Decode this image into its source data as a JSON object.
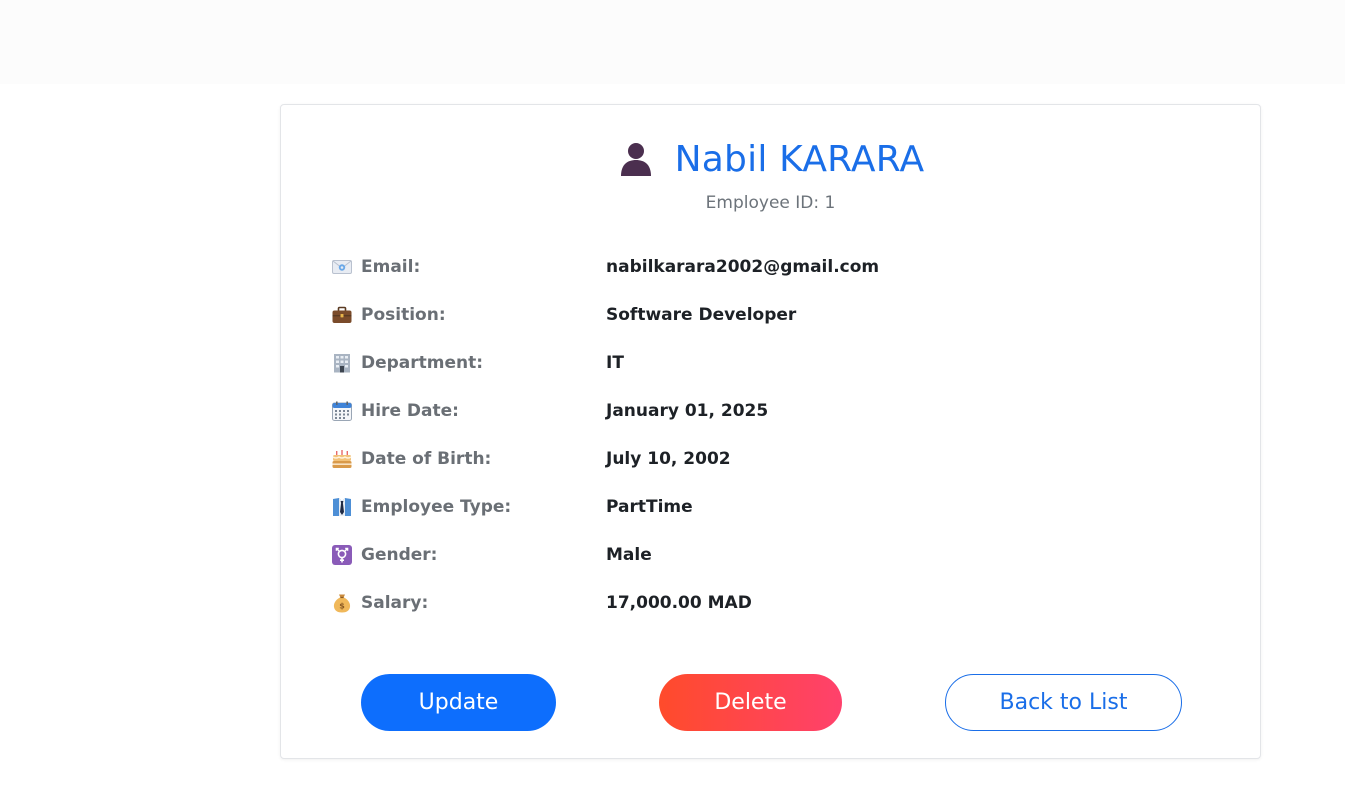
{
  "profile": {
    "name": "Nabil KARARA",
    "employee_id_label": "Employee ID: 1"
  },
  "details": [
    {
      "icon": "envelope-icon",
      "label": "Email:",
      "value": "nabilkarara2002@gmail.com"
    },
    {
      "icon": "briefcase-icon",
      "label": "Position:",
      "value": "Software Developer"
    },
    {
      "icon": "office-building-icon",
      "label": "Department:",
      "value": "IT"
    },
    {
      "icon": "calendar-icon",
      "label": "Hire Date:",
      "value": "January 01, 2025"
    },
    {
      "icon": "birthday-cake-icon",
      "label": "Date of Birth:",
      "value": "July 10, 2002"
    },
    {
      "icon": "necktie-icon",
      "label": "Employee Type:",
      "value": "PartTime"
    },
    {
      "icon": "gender-icon",
      "label": "Gender:",
      "value": "Male"
    },
    {
      "icon": "money-bag-icon",
      "label": "Salary:",
      "value": "17,000.00 MAD"
    }
  ],
  "actions": {
    "update_label": "Update",
    "delete_label": "Delete",
    "back_label": "Back to List"
  },
  "colors": {
    "primary": "#0d6efd",
    "name_text": "#1a6ee8",
    "delete_start": "#ff4b2b",
    "delete_end": "#ff416c"
  }
}
